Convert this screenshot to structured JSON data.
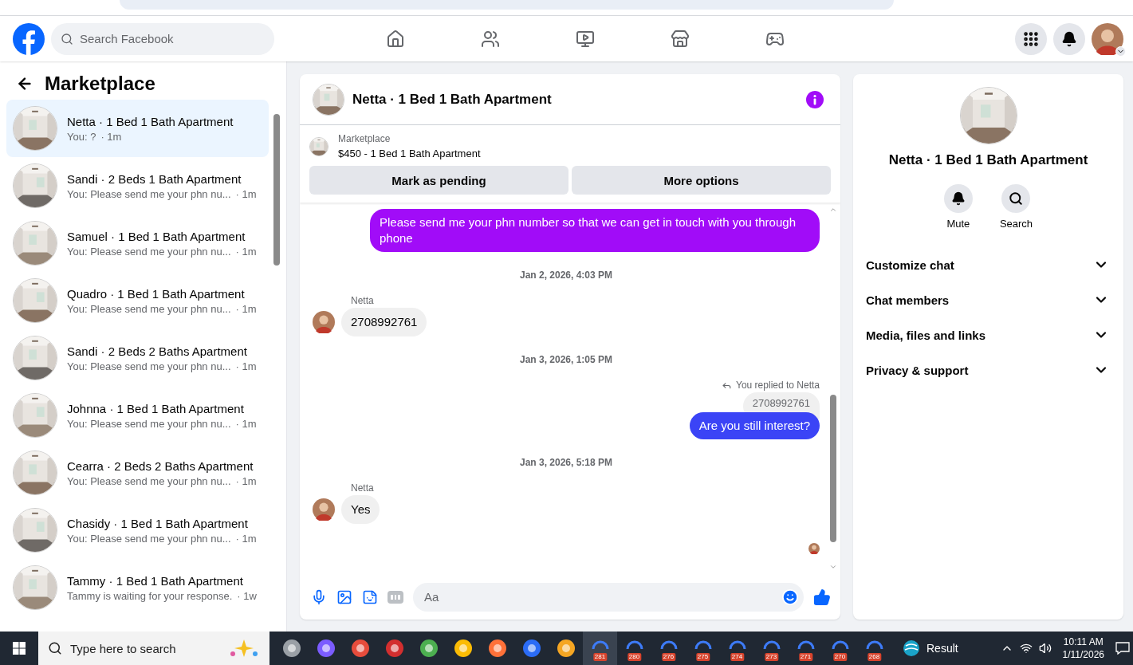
{
  "header": {
    "search_placeholder": "Search Facebook",
    "nav": [
      {
        "kind": "home"
      },
      {
        "kind": "friends"
      },
      {
        "kind": "video"
      },
      {
        "kind": "marketplace"
      },
      {
        "kind": "gaming"
      }
    ]
  },
  "sidebar": {
    "title": "Marketplace",
    "conversations": [
      {
        "name": "Netta · 1 Bed 1 Bath Apartment",
        "preview": "You: ?",
        "time": "· 1m",
        "selected": true
      },
      {
        "name": "Sandi · 2 Beds 1 Bath Apartment",
        "preview": "You: Please send me your phn nu...",
        "time": "· 1m",
        "selected": false
      },
      {
        "name": "Samuel · 1 Bed 1 Bath Apartment",
        "preview": "You: Please send me your phn nu...",
        "time": "· 1m",
        "selected": false
      },
      {
        "name": "Quadro · 1 Bed 1 Bath Apartment",
        "preview": "You: Please send me your phn nu...",
        "time": "· 1m",
        "selected": false
      },
      {
        "name": "Sandi · 2 Beds 2 Baths Apartment",
        "preview": "You: Please send me your phn nu...",
        "time": "· 1m",
        "selected": false
      },
      {
        "name": "Johnna · 1 Bed 1 Bath Apartment",
        "preview": "You: Please send me your phn nu...",
        "time": "· 1m",
        "selected": false
      },
      {
        "name": "Cearra · 2 Beds 2 Baths Apartment",
        "preview": "You: Please send me your phn nu...",
        "time": "· 1m",
        "selected": false
      },
      {
        "name": "Chasidy · 1 Bed 1 Bath Apartment",
        "preview": "You: Please send me your phn nu...",
        "time": "· 1m",
        "selected": false
      },
      {
        "name": "Tammy · 1 Bed 1 Bath Apartment",
        "preview": "Tammy is waiting for your response.",
        "time": "· 1w",
        "selected": false
      }
    ]
  },
  "chat": {
    "title": "Netta · 1 Bed 1 Bath Apartment",
    "listing": {
      "label": "Marketplace",
      "item": "$450 - 1 Bed 1 Bath Apartment",
      "buttons": [
        "Mark as pending",
        "More options"
      ]
    },
    "messages": [
      {
        "kind": "outgoing",
        "text": "Please send me your phn number so that we can get in touch with you through phone",
        "color": "#a10cf8"
      },
      {
        "kind": "timestamp",
        "text": "Jan 2, 2026, 4:03 PM"
      },
      {
        "kind": "incoming",
        "sender": "Netta",
        "text": "2708992761"
      },
      {
        "kind": "timestamp",
        "text": "Jan 3, 2026, 1:05 PM"
      },
      {
        "kind": "reply",
        "note": "You replied to Netta",
        "quoted": "2708992761",
        "text": "Are you still interest?",
        "color": "#3b44f6"
      },
      {
        "kind": "timestamp",
        "text": "Jan 3, 2026, 5:18 PM"
      },
      {
        "kind": "incoming",
        "sender": "Netta",
        "text": "Yes"
      },
      {
        "kind": "seen"
      }
    ],
    "composer_placeholder": "Aa"
  },
  "details": {
    "name": "Netta · 1 Bed 1 Bath Apartment",
    "actions": [
      {
        "kind": "mute",
        "label": "Mute"
      },
      {
        "kind": "search",
        "label": "Search"
      }
    ],
    "sections": [
      "Customize chat",
      "Chat members",
      "Media, files and links",
      "Privacy & support"
    ]
  },
  "taskbar": {
    "search_placeholder": "Type here to search",
    "badges": [
      "281",
      "280",
      "276",
      "275",
      "274",
      "273",
      "271",
      "270",
      "268"
    ],
    "weather": "Result",
    "time": "10:11 AM",
    "date": "1/11/2026"
  }
}
